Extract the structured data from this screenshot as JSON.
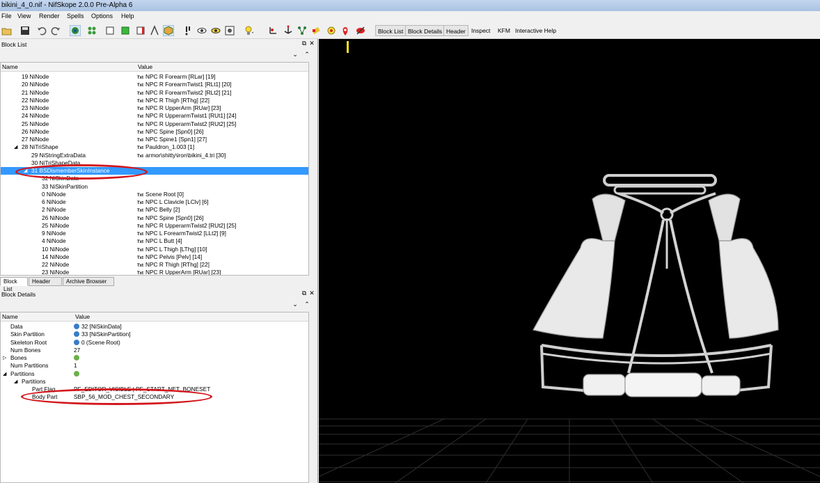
{
  "window": {
    "title": "bikini_4_0.nif - NifSkope 2.0.0 Pre-Alpha 6"
  },
  "menu": [
    "File",
    "View",
    "Render",
    "Spells",
    "Options",
    "Help"
  ],
  "toolbar_text": [
    "Block List",
    "Block Details",
    "Header",
    "Inspect",
    "KFM",
    "Interactive Help"
  ],
  "block_list": {
    "title": "Block List",
    "col_name": "Name",
    "col_value": "Value",
    "rows": [
      {
        "name": "19 NiNode",
        "value": "NPC R Forearm [RLar] [19]",
        "indent": 30
      },
      {
        "name": "20 NiNode",
        "value": "NPC R ForearmTwist1 [RLt1] [20]",
        "indent": 30
      },
      {
        "name": "21 NiNode",
        "value": "NPC R ForearmTwist2 [RLt2] [21]",
        "indent": 30
      },
      {
        "name": "22 NiNode",
        "value": "NPC R Thigh [RThg] [22]",
        "indent": 30
      },
      {
        "name": "23 NiNode",
        "value": "NPC R UpperArm [RUar] [23]",
        "indent": 30
      },
      {
        "name": "24 NiNode",
        "value": "NPC R UpperarmTwist1 [RUt1] [24]",
        "indent": 30
      },
      {
        "name": "25 NiNode",
        "value": "NPC R UpperarmTwist2 [RUt2] [25]",
        "indent": 30
      },
      {
        "name": "26 NiNode",
        "value": "NPC Spine [Spn0] [26]",
        "indent": 30
      },
      {
        "name": "27 NiNode",
        "value": "NPC Spine1 [Spn1] [27]",
        "indent": 30
      },
      {
        "name": "28 NiTriShape",
        "value": "Pauldron_1.003 [1]",
        "indent": 30,
        "arrow": true
      },
      {
        "name": "29 NiStringExtraData",
        "value": "armor\\shitty\\iron\\bikini_4.tri [30]",
        "indent": 44
      },
      {
        "name": "30 NiTriShapeData",
        "value": "",
        "indent": 44
      },
      {
        "name": "31 BSDismemberSkinInstance",
        "value": "",
        "indent": 44,
        "arrow": true,
        "selected": true
      },
      {
        "name": "32 NiSkinData",
        "value": "",
        "indent": 59
      },
      {
        "name": "33 NiSkinPartition",
        "value": "",
        "indent": 59
      },
      {
        "name": "0 NiNode",
        "value": "Scene Root [0]",
        "indent": 59
      },
      {
        "name": "6 NiNode",
        "value": "NPC L Clavicle [LClv] [6]",
        "indent": 59
      },
      {
        "name": "2 NiNode",
        "value": "NPC Belly [2]",
        "indent": 59
      },
      {
        "name": "26 NiNode",
        "value": "NPC Spine [Spn0] [26]",
        "indent": 59
      },
      {
        "name": "25 NiNode",
        "value": "NPC R UpperarmTwist2 [RUt2] [25]",
        "indent": 59
      },
      {
        "name": "9 NiNode",
        "value": "NPC L ForearmTwist2 [LLt2] [9]",
        "indent": 59
      },
      {
        "name": "4 NiNode",
        "value": "NPC L Butt [4]",
        "indent": 59
      },
      {
        "name": "10 NiNode",
        "value": "NPC L Thigh [LThg] [10]",
        "indent": 59
      },
      {
        "name": "14 NiNode",
        "value": "NPC Pelvis [Pelv] [14]",
        "indent": 59
      },
      {
        "name": "22 NiNode",
        "value": "NPC R Thigh [RThg] [22]",
        "indent": 59
      },
      {
        "name": "23 NiNode",
        "value": "NPC R UpperArm [RUar] [23]",
        "indent": 59
      }
    ],
    "txt_tag": "Txt",
    "tabs": [
      "Block List",
      "Header",
      "Archive Browser"
    ]
  },
  "block_details": {
    "title": "Block Details",
    "col_name": "Name",
    "col_value": "Value",
    "rows": [
      {
        "name": "Data",
        "value": "32 [NiSkinData]",
        "indent": 14,
        "icon": "link"
      },
      {
        "name": "Skin Partition",
        "value": "33 [NiSkinPartition]",
        "indent": 14,
        "icon": "link"
      },
      {
        "name": "Skeleton Root",
        "value": "0 (Scene Root)",
        "indent": 14,
        "icon": "link"
      },
      {
        "name": "Num Bones",
        "value": "27",
        "indent": 14
      },
      {
        "name": "Bones",
        "value": "",
        "indent": 14,
        "icon": "array",
        "expand": "closed"
      },
      {
        "name": "Num Partitions",
        "value": "1",
        "indent": 14
      },
      {
        "name": "Partitions",
        "value": "",
        "indent": 14,
        "icon": "array",
        "expand": "open"
      },
      {
        "name": "Partitions",
        "value": "",
        "indent": 30,
        "expand": "open"
      },
      {
        "name": "Part Flag",
        "value": "PF_EDITOR_VISIBLE | PF_START_NET_BONESET",
        "indent": 45
      },
      {
        "name": "Body Part",
        "value": "SBP_56_MOD_CHEST_SECONDARY",
        "indent": 45
      }
    ]
  },
  "icons": [
    "open-icon",
    "save-icon",
    "undo-icon",
    "redo-icon",
    "select-icon",
    "node-icon",
    "view-front-icon",
    "view-top-icon",
    "view-side-icon",
    "view-user-icon",
    "view-walk-icon",
    "texture-icon",
    "pointer-icon",
    "eye-icon",
    "visibility-icon",
    "screenshot-icon",
    "lightbulb-icon",
    "axes-icon",
    "bones-icon",
    "nodes-icon",
    "collision-icon",
    "constraint-icon",
    "marker-icon",
    "hidden-icon"
  ],
  "colors": {
    "selection": "#3399ff",
    "highlight_ellipse": "#d3161c",
    "viewport_bg": "#000000",
    "grid": "#2a2a2a"
  }
}
